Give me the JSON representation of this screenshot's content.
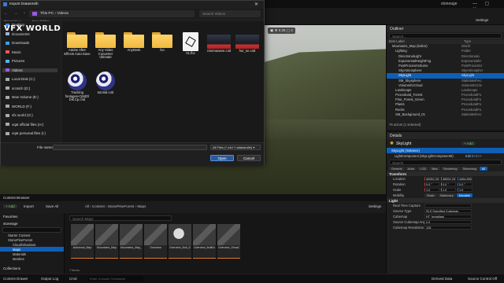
{
  "ue": {
    "project": "stoneage",
    "settings": "Settings",
    "viewport_tools": "▣ ⚙ 0.25 ▢ 4"
  },
  "outliner": {
    "title": "Outliner",
    "search_placeholder": "Search...",
    "col_label": "Item Label",
    "col_type": "Type",
    "rows": [
      {
        "label": "Mountains_Map (Editor)",
        "type": "World",
        "indent": 1
      },
      {
        "label": "Lighting",
        "type": "Folder",
        "indent": 2
      },
      {
        "label": "DirectionalLight",
        "type": "DirectionalLi",
        "indent": 3
      },
      {
        "label": "ExponentialHeightFog",
        "type": "ExponentialH",
        "indent": 3
      },
      {
        "label": "PostProcessVolume",
        "type": "PostProcessV",
        "indent": 3
      },
      {
        "label": "SkyAtmosphere",
        "type": "SkyAtmospher",
        "indent": 3
      },
      {
        "label": "SkyLight",
        "type": "SkyLight",
        "indent": 3,
        "selected": true
      },
      {
        "label": "SM_Skysphere",
        "type": "StaticMeshAc",
        "indent": 3
      },
      {
        "label": "VolumetricCloud",
        "type": "VolumetricClo",
        "indent": 3
      },
      {
        "label": "Landscape",
        "type": "Landscape",
        "indent": 2
      },
      {
        "label": "Procedural_Forest",
        "type": "ProceduralFo",
        "indent": 2
      },
      {
        "label": "Pine_Forest_Green",
        "type": "ProceduralFo",
        "indent": 2
      },
      {
        "label": "Plants",
        "type": "ProceduralFo",
        "indent": 2
      },
      {
        "label": "Rocks",
        "type": "ProceduralFo",
        "indent": 2
      },
      {
        "label": "SM_Background_01",
        "type": "StaticMeshAc",
        "indent": 2
      }
    ],
    "footer": "76 actors (1 selected)"
  },
  "details": {
    "title": "Details",
    "actor_name": "SkyLight",
    "add_label": "+ Add",
    "instance_label": "SkyLight (Instance)",
    "component_label": "LightComponent (SkyLightComponent0)",
    "edit_link": "Edit in C++",
    "search_placeholder": "Search",
    "tabs": [
      "General",
      "Actor",
      "LOD",
      "Misc",
      "Rendering",
      "Streaming",
      "All"
    ],
    "active_tab": "All",
    "transform_header": "Transform",
    "transform": [
      {
        "label": "Location",
        "values": [
          "40062.300",
          "38592.267",
          "4464.8906"
        ]
      },
      {
        "label": "Rotation",
        "values": [
          "0.0 °",
          "0.0 °",
          "0.0 °"
        ]
      },
      {
        "label": "Scale",
        "values": [
          "1.0",
          "1.0",
          "1.0"
        ]
      }
    ],
    "mobility_label": "Mobility",
    "mobility_options": [
      "Static",
      "Stationary",
      "Movable"
    ],
    "mobility_selected": "Movable",
    "light_header": "Light",
    "light_rows": [
      {
        "label": "Real Time Capture",
        "value": ""
      },
      {
        "label": "Source Type",
        "value": "SLS Specified Cubemap"
      },
      {
        "label": "Cubemap",
        "value": "HT_breakfast"
      },
      {
        "label": "Source Cubemap Angle",
        "value": "0.0"
      },
      {
        "label": "Cubemap Resolution",
        "value": "128"
      }
    ]
  },
  "content_browser": {
    "tabs": [
      "Content Browser"
    ],
    "add_label": "+ Add",
    "import_label": "Import",
    "save_all_label": "Save All",
    "breadcrumb": [
      "All",
      "Content",
      "StonePineForest",
      "Maps"
    ],
    "settings": "Settings",
    "favorites": "Favorites",
    "project": "stoneage",
    "search_placeholder": "Search Maps",
    "tree": [
      "Starter Content",
      "StonePineForest",
      "Cloud/Shadows",
      "Maps",
      "Materials",
      "Meshes"
    ],
    "collections": "Collections",
    "items_count": "7 items",
    "assets": [
      "Autumnal_Map",
      "Mountains_Map",
      "Mountains_Map_Sh",
      "Overview",
      "Overview_Bolt_Dam",
      "Overview_BuiltData",
      "Overview_ShowCase"
    ]
  },
  "status_bar": {
    "content_drawer": "Content Drawer",
    "output_log": "Output Log",
    "cmd": "Cmd",
    "console_placeholder": "Enter Console Command",
    "derived_data": "Derived Data",
    "source_control": "Source Control Off"
  },
  "dialog": {
    "title": "Import Datasmith",
    "path": [
      "This PC",
      "Videos"
    ],
    "search_placeholder": "Search Videos",
    "organize": "Organize ▾",
    "new_folder": "New folder",
    "sidebar": [
      {
        "label": "Desktop",
        "icon": "desktop-icon",
        "color": "#3a8ee6"
      },
      {
        "label": "Documents",
        "icon": "documents-icon",
        "color": "#9cb4d6"
      },
      {
        "label": "Downloads",
        "icon": "downloads-icon",
        "color": "#3aa0e6"
      },
      {
        "label": "Music",
        "icon": "music-icon",
        "color": "#e65a5a"
      },
      {
        "label": "Pictures",
        "icon": "pictures-icon",
        "color": "#5ab4e6"
      },
      {
        "label": "Videos",
        "icon": "videos-icon",
        "color": "#9a5ae6",
        "selected": true
      },
      {
        "label": "Local Disk (C:)",
        "icon": "disk-icon",
        "color": "#aaaaaa"
      },
      {
        "label": "scratch (D:)",
        "icon": "disk-icon",
        "color": "#aaaaaa"
      },
      {
        "label": "New Volume (E:)",
        "icon": "disk-icon",
        "color": "#aaaaaa"
      },
      {
        "label": "WORLD (F:)",
        "icon": "disk-icon",
        "color": "#aaaaaa"
      },
      {
        "label": "vfx world (G:)",
        "icon": "disk-icon",
        "color": "#aaaaaa"
      },
      {
        "label": "vqat official files (H:)",
        "icon": "disk-icon",
        "color": "#aaaaaa"
      },
      {
        "label": "vqat personal files (I:)",
        "icon": "disk-icon",
        "color": "#aaaaaa"
      }
    ],
    "files": [
      {
        "name": "Adobe After Effects Auto-Save",
        "kind": "folder"
      },
      {
        "name": "Any Video Converter Ultimate",
        "kind": "folder"
      },
      {
        "name": "AnyDesk",
        "kind": "folder"
      },
      {
        "name": "fxn",
        "kind": "folder"
      },
      {
        "name": "01.fbx",
        "kind": "fbx"
      },
      {
        "name": "cinemaware.c4d",
        "kind": "clip"
      },
      {
        "name": "hur_se.c4d",
        "kind": "clip"
      },
      {
        "name": "Tracking footages-Cj9dOl Dik.Cp.c4d",
        "kind": "c4d"
      },
      {
        "name": "tutorial.c4d",
        "kind": "c4d"
      }
    ],
    "file_name_label": "File name:",
    "file_name_value": "",
    "file_type": "All Files (*.c4d *.udatasmith) ▾",
    "open_label": "Open",
    "cancel_label": "Cancel"
  },
  "watermark": "VFX WORLD"
}
